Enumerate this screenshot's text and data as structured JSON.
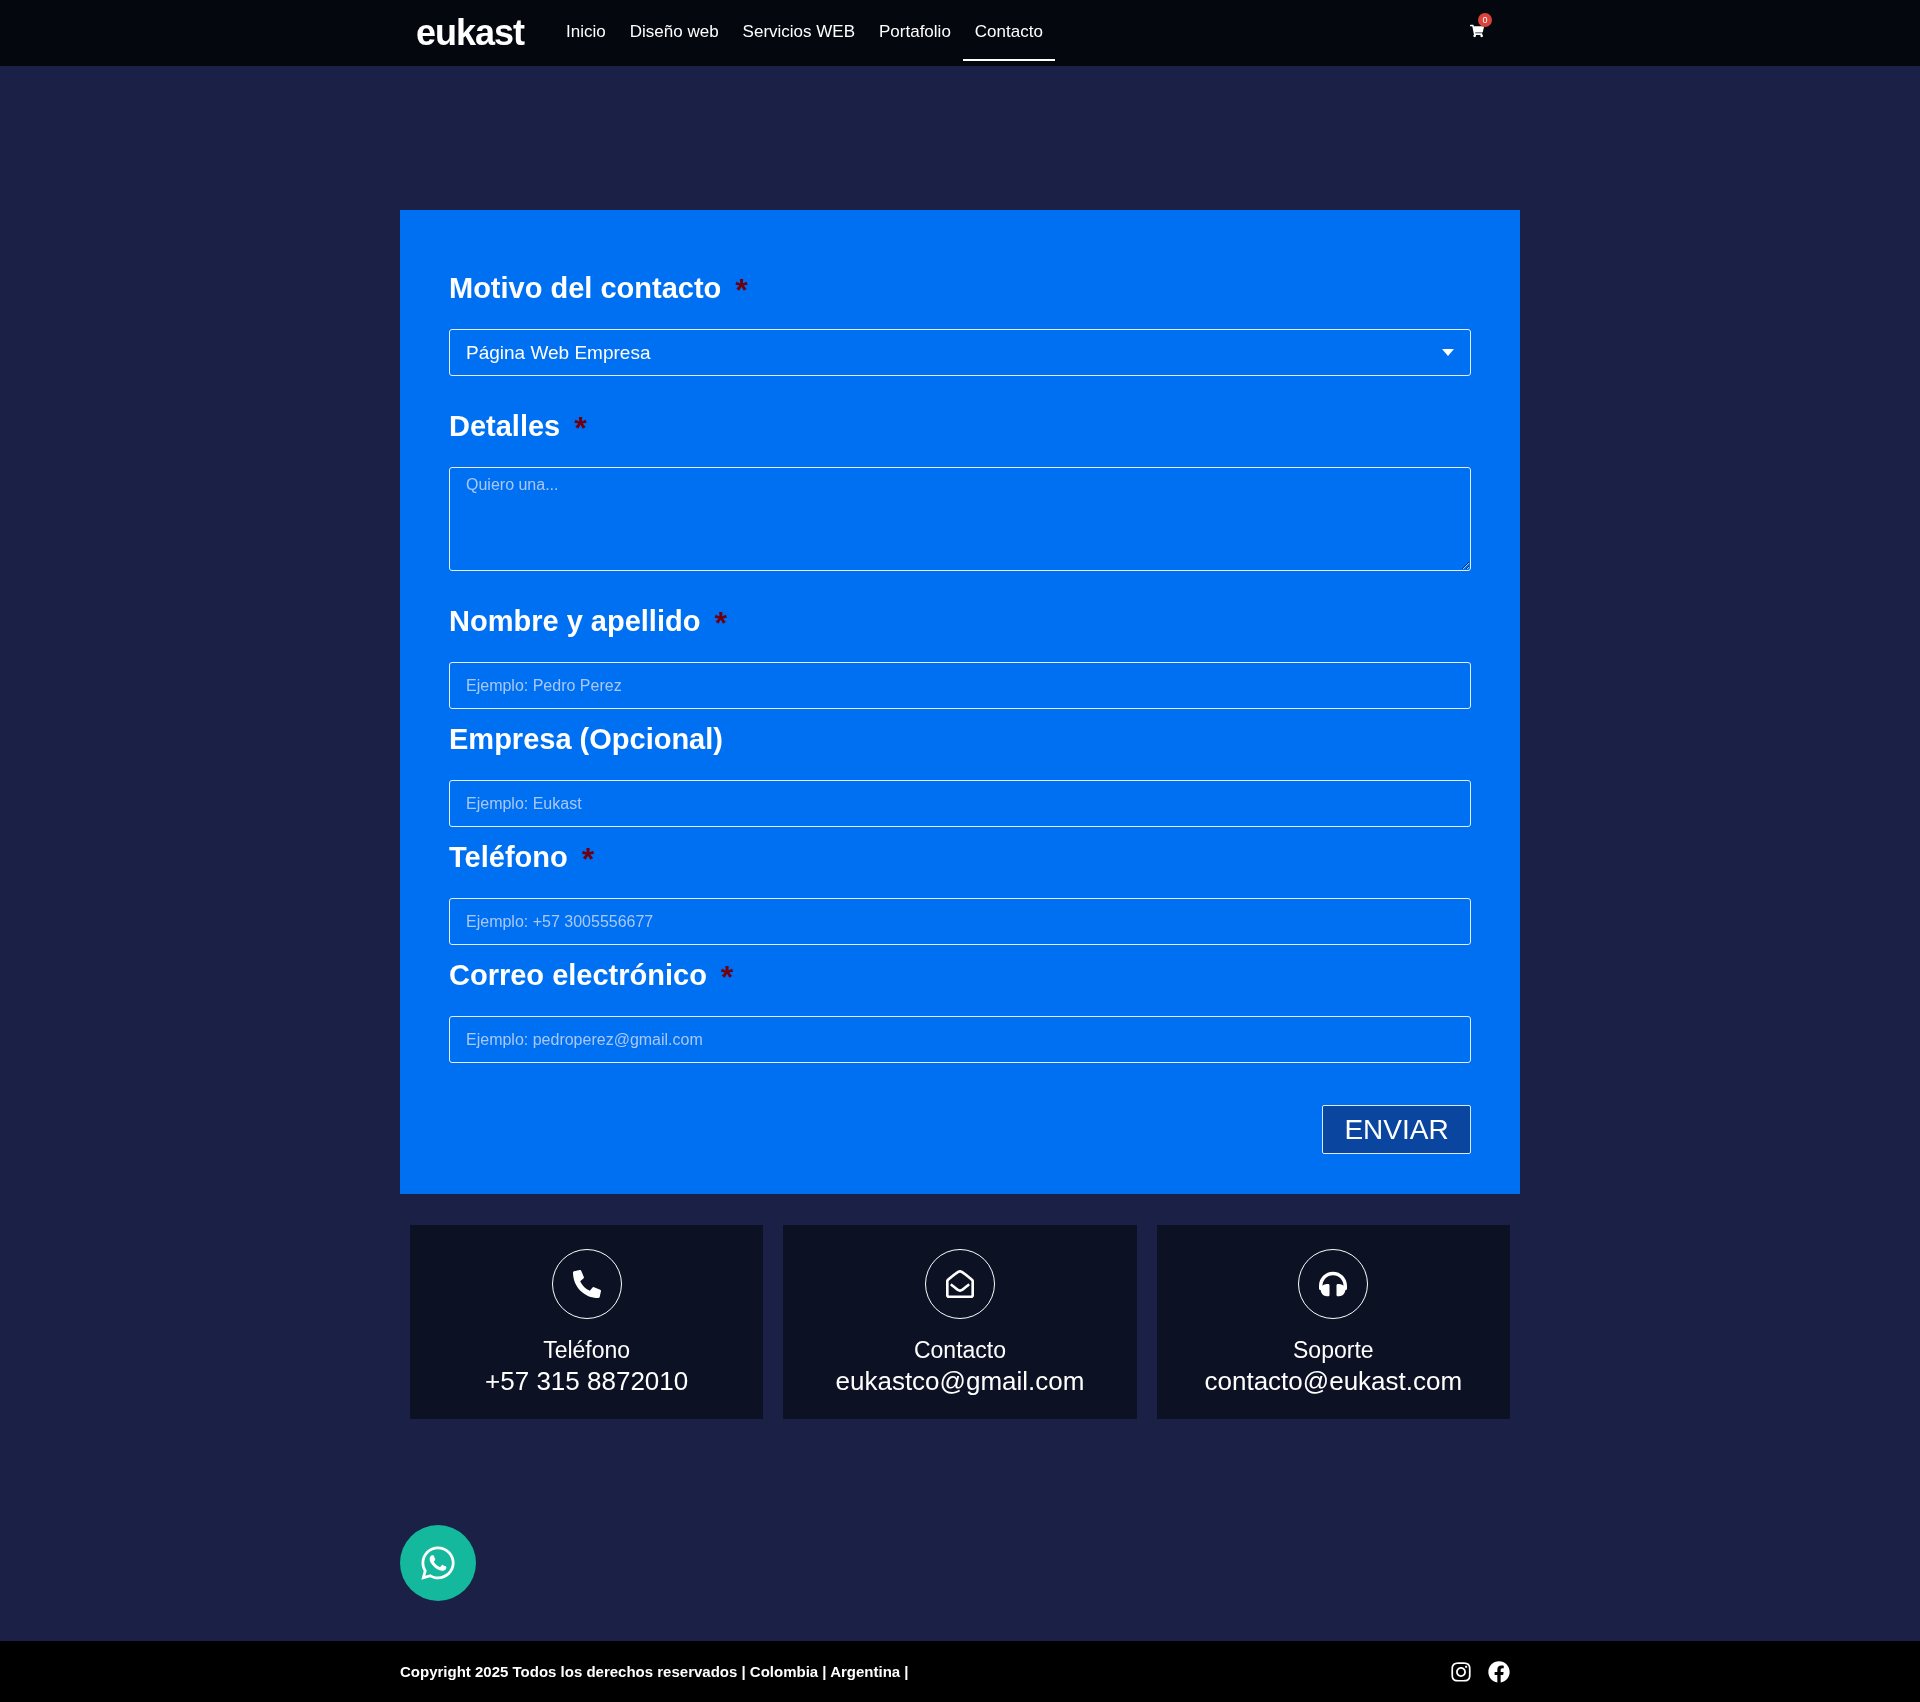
{
  "header": {
    "logo": "eukast",
    "nav": [
      {
        "label": "Inicio",
        "selected": false
      },
      {
        "label": "Diseño web",
        "selected": false
      },
      {
        "label": "Servicios WEB",
        "selected": false
      },
      {
        "label": "Portafolio",
        "selected": false
      },
      {
        "label": "Contacto",
        "selected": true
      }
    ],
    "cart_count": "0"
  },
  "form": {
    "required_mark": "*",
    "fields": [
      {
        "kind": "select",
        "label": "Motivo del contacto",
        "required": true,
        "value": "Página Web Empresa"
      },
      {
        "kind": "textarea",
        "label": "Detalles",
        "required": true,
        "placeholder": "Quiero una..."
      },
      {
        "kind": "input",
        "label": "Nombre y apellido",
        "required": true,
        "placeholder": "Ejemplo: Pedro Perez"
      },
      {
        "kind": "input",
        "label": "Empresa (Opcional)",
        "required": false,
        "placeholder": "Ejemplo: Eukast"
      },
      {
        "kind": "input",
        "label": "Teléfono",
        "required": true,
        "placeholder": "Ejemplo: +57 3005556677"
      },
      {
        "kind": "input",
        "label": "Correo electrónico",
        "required": true,
        "placeholder": "Ejemplo: pedroperez@gmail.com"
      }
    ],
    "submit": "ENVIAR"
  },
  "contact_cards": [
    {
      "kind": "phone",
      "title": "Teléfono",
      "value": "+57 315 8872010"
    },
    {
      "kind": "email",
      "title": "Contacto",
      "value": "eukastco@gmail.com"
    },
    {
      "kind": "support",
      "title": "Soporte",
      "value": "contacto@eukast.com"
    }
  ],
  "footer": {
    "copyright": "Copyright 2025 Todos los derechos reservados | Colombia | Argentina |"
  }
}
